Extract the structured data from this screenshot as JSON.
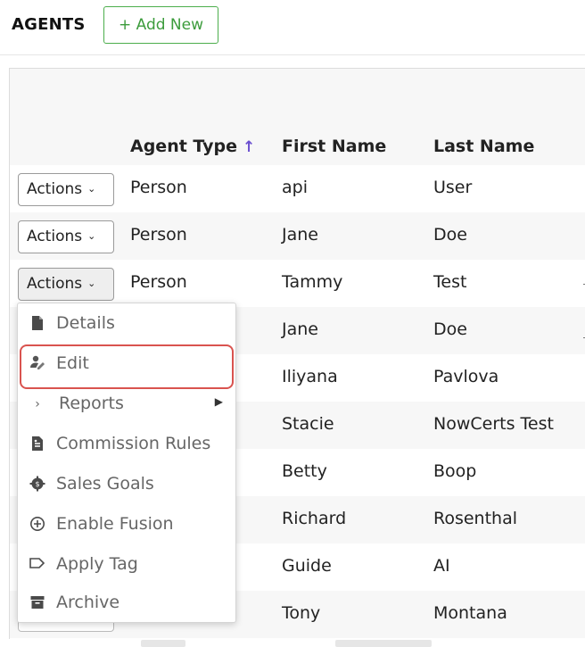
{
  "header": {
    "title": "AGENTS",
    "add_new_label": "+ Add New"
  },
  "table": {
    "columns": [
      {
        "label": "Agent Type",
        "sorted": "ascending"
      },
      {
        "label": "First Name"
      },
      {
        "label": "Last Name"
      }
    ],
    "sort_indicator": "↑",
    "action_label": "Actions",
    "rows": [
      {
        "agent_type": "Person",
        "first_name": "api",
        "last_name": "User"
      },
      {
        "agent_type": "Person",
        "first_name": "Jane",
        "last_name": "Doe"
      },
      {
        "agent_type": "Person",
        "first_name": "Tammy",
        "last_name": "Test"
      },
      {
        "agent_type": "",
        "first_name": "Jane",
        "last_name": "Doe"
      },
      {
        "agent_type": "",
        "first_name": "Iliyana",
        "last_name": "Pavlova"
      },
      {
        "agent_type": "",
        "first_name": "Stacie",
        "last_name": "NowCerts Test"
      },
      {
        "agent_type": "",
        "first_name": "Betty",
        "last_name": "Boop"
      },
      {
        "agent_type": "",
        "first_name": "Richard",
        "last_name": "Rosenthal"
      },
      {
        "agent_type": "",
        "first_name": "Guide",
        "last_name": "AI"
      },
      {
        "agent_type": "",
        "first_name": "Tony",
        "last_name": "Montana"
      }
    ]
  },
  "actions_menu": {
    "items": [
      {
        "label": "Details",
        "icon": "document-icon"
      },
      {
        "label": "Edit",
        "icon": "user-edit-icon"
      },
      {
        "label": "Reports",
        "icon": "chevron-right-icon"
      },
      {
        "label": "Commission Rules",
        "icon": "rules-doc-icon"
      },
      {
        "label": "Sales Goals",
        "icon": "gear-badge-icon"
      },
      {
        "label": "Enable Fusion",
        "icon": "plus-circle-icon"
      },
      {
        "label": "Apply Tag",
        "icon": "tag-icon"
      },
      {
        "label": "Archive",
        "icon": "archive-icon"
      }
    ]
  },
  "colors": {
    "add_new_border": "#4cae4c",
    "sort_arrow": "#6a4fd0",
    "highlight_border": "#d9534f",
    "row_alt": "#f7f7f7"
  }
}
